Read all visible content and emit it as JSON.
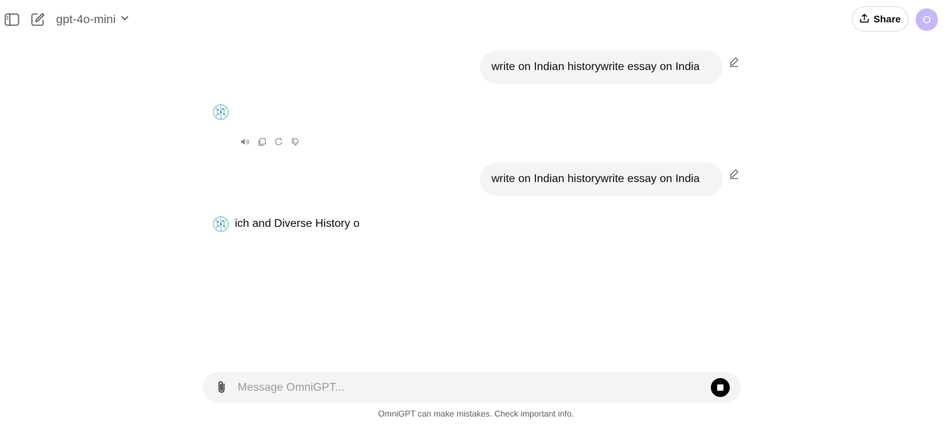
{
  "header": {
    "model_name": "gpt-4o-mini",
    "share_label": "Share",
    "avatar_initial": "O"
  },
  "icons": {
    "sidebar_toggle": "sidebar-toggle-icon",
    "new_chat": "new-chat-icon",
    "model_dropdown": "chevron-down-icon",
    "share": "share-upload-icon",
    "edit": "pencil-icon",
    "read_aloud": "speaker-icon",
    "copy": "copy-icon",
    "regenerate": "refresh-icon",
    "dislike": "thumbs-down-icon",
    "attach": "paperclip-icon",
    "stop": "stop-icon"
  },
  "messages": [
    {
      "role": "user",
      "text": "write on Indian historywrite essay on India"
    },
    {
      "role": "assistant",
      "text": ""
    },
    {
      "role": "user",
      "text": "write on Indian historywrite essay on India"
    },
    {
      "role": "assistant",
      "text": "ich and Diverse History o"
    }
  ],
  "composer": {
    "placeholder": "Message OmniGPT..."
  },
  "footer": {
    "disclaimer": "OmniGPT can make mistakes. Check important info."
  },
  "colors": {
    "avatar_bg": "#c7b8f5",
    "bubble_bg": "#f4f4f4",
    "stop_button": "#000000"
  }
}
